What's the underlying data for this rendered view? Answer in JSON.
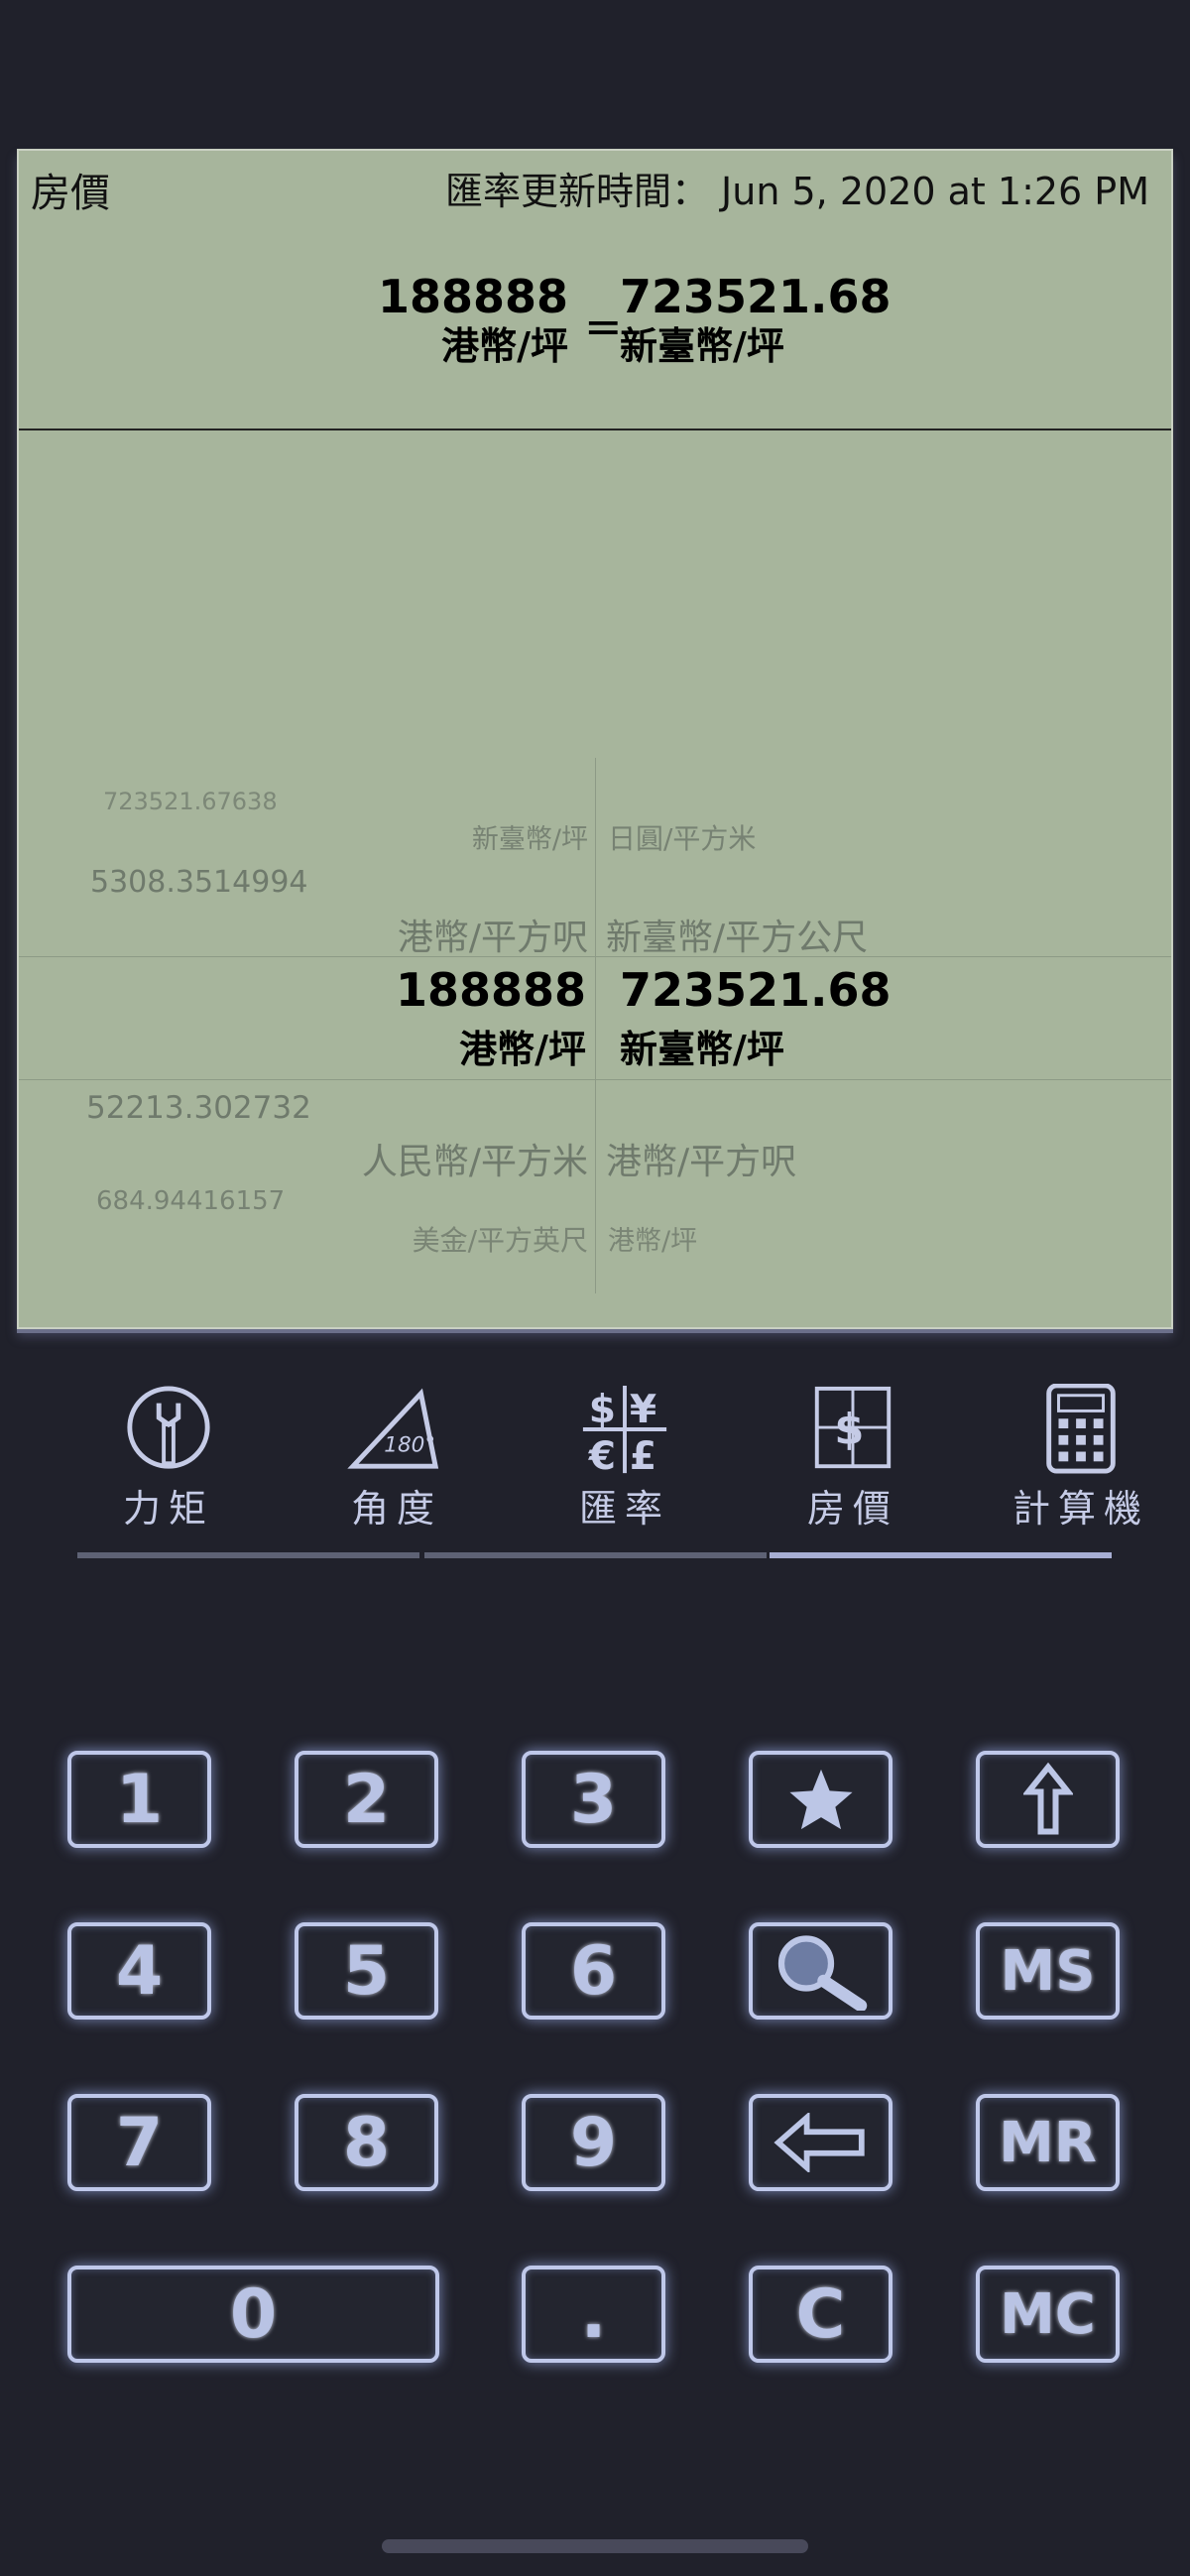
{
  "display": {
    "mode": "房價",
    "update_label": "匯率更新時間：",
    "update_time": "Jun 5, 2020 at 1:26 PM",
    "from_value": "188888",
    "from_unit": "港幣/坪",
    "equals": "=",
    "to_value": "723521.68",
    "to_unit": "新臺幣/坪"
  },
  "picker": {
    "left_column": [
      {
        "value": "723521.67638",
        "unit": "新臺幣/坪"
      },
      {
        "value": "5308.3514994",
        "unit": "港幣/平方呎"
      },
      {
        "value": "188888",
        "unit": "港幣/坪",
        "selected": true
      },
      {
        "value": "52213.302732",
        "unit": "人民幣/平方米"
      },
      {
        "value": "684.94416157",
        "unit": "美金/平方英尺"
      }
    ],
    "right_column": [
      {
        "unit": "日圓/平方米"
      },
      {
        "unit": "新臺幣/平方公尺"
      },
      {
        "value": "723521.68",
        "unit": "新臺幣/坪",
        "selected": true
      },
      {
        "unit": "港幣/平方呎"
      },
      {
        "unit": "港幣/坪"
      }
    ]
  },
  "tabs": [
    {
      "label": "力矩",
      "icon": "wrench-icon"
    },
    {
      "label": "角度",
      "icon": "angle-icon"
    },
    {
      "label": "匯率",
      "icon": "currency-icon"
    },
    {
      "label": "房價",
      "icon": "house-price-icon",
      "active": true
    },
    {
      "label": "計算機",
      "icon": "calculator-icon"
    }
  ],
  "keypad": {
    "k1": "1",
    "k2": "2",
    "k3": "3",
    "k4": "4",
    "k5": "5",
    "k6": "6",
    "k7": "7",
    "k8": "8",
    "k9": "9",
    "k0": "0",
    "dot": ".",
    "clear": "C",
    "ms": "MS",
    "mr": "MR",
    "mc": "MC"
  },
  "colors": {
    "background": "#20212b",
    "display": "#a7b59c",
    "key_glow": "#bfc8ea"
  }
}
